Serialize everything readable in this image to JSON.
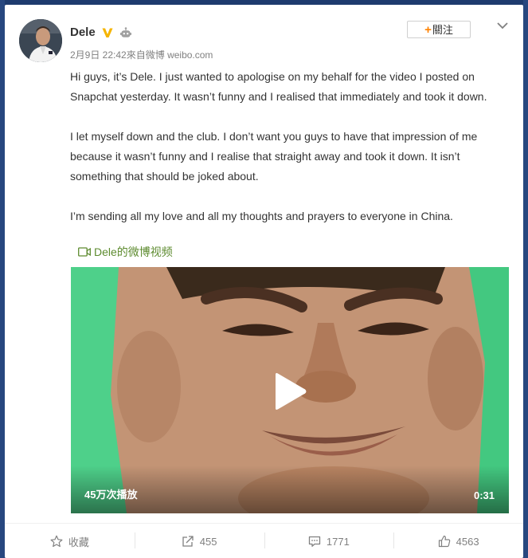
{
  "post": {
    "username": "Dele",
    "date": "2月9日 22:42",
    "source_prefix": "來自",
    "source": "微博 weibo.com",
    "follow_label": "關注",
    "paragraphs": [
      "Hi guys, it’s Dele. I just wanted to apologise on my behalf for the video I posted on Snapchat yesterday. It wasn’t funny and I realised that immediately and took it down.",
      "I let myself down and the club. I don’t want you guys to have that impression of me because it wasn’t funny and I realise that straight away and took it down. It isn’t something that should be joked about.",
      "I’m sending all my love and all my thoughts and prayers to everyone in China."
    ],
    "video_link": "Dele的微博视频",
    "video": {
      "views": "45万次播放",
      "duration": "0:31"
    }
  },
  "actions": {
    "favorite": "收藏",
    "repost": "455",
    "comment": "1771",
    "like": "4563"
  },
  "icons": [
    "verified-badge-icon",
    "robot-icon",
    "chevron-down-icon",
    "video-camera-icon",
    "play-icon",
    "star-icon",
    "share-icon",
    "comment-icon",
    "thumbs-up-icon"
  ],
  "colors": {
    "accent_orange": "#ff8200",
    "verified_gold": "#f5b400",
    "video_link_green": "#5d8b2f",
    "video_background_green": "#43c880"
  }
}
